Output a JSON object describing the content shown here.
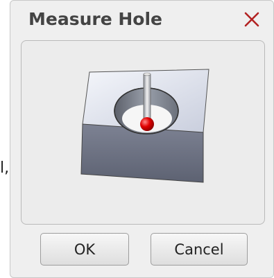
{
  "background": {
    "partial_text": "l,"
  },
  "dialog": {
    "title": "Measure Hole",
    "close_icon": "close-x-icon",
    "close_color": "#b22222",
    "preview_icon": "hole-probe-illustration",
    "buttons": {
      "ok": "OK",
      "cancel": "Cancel"
    }
  }
}
